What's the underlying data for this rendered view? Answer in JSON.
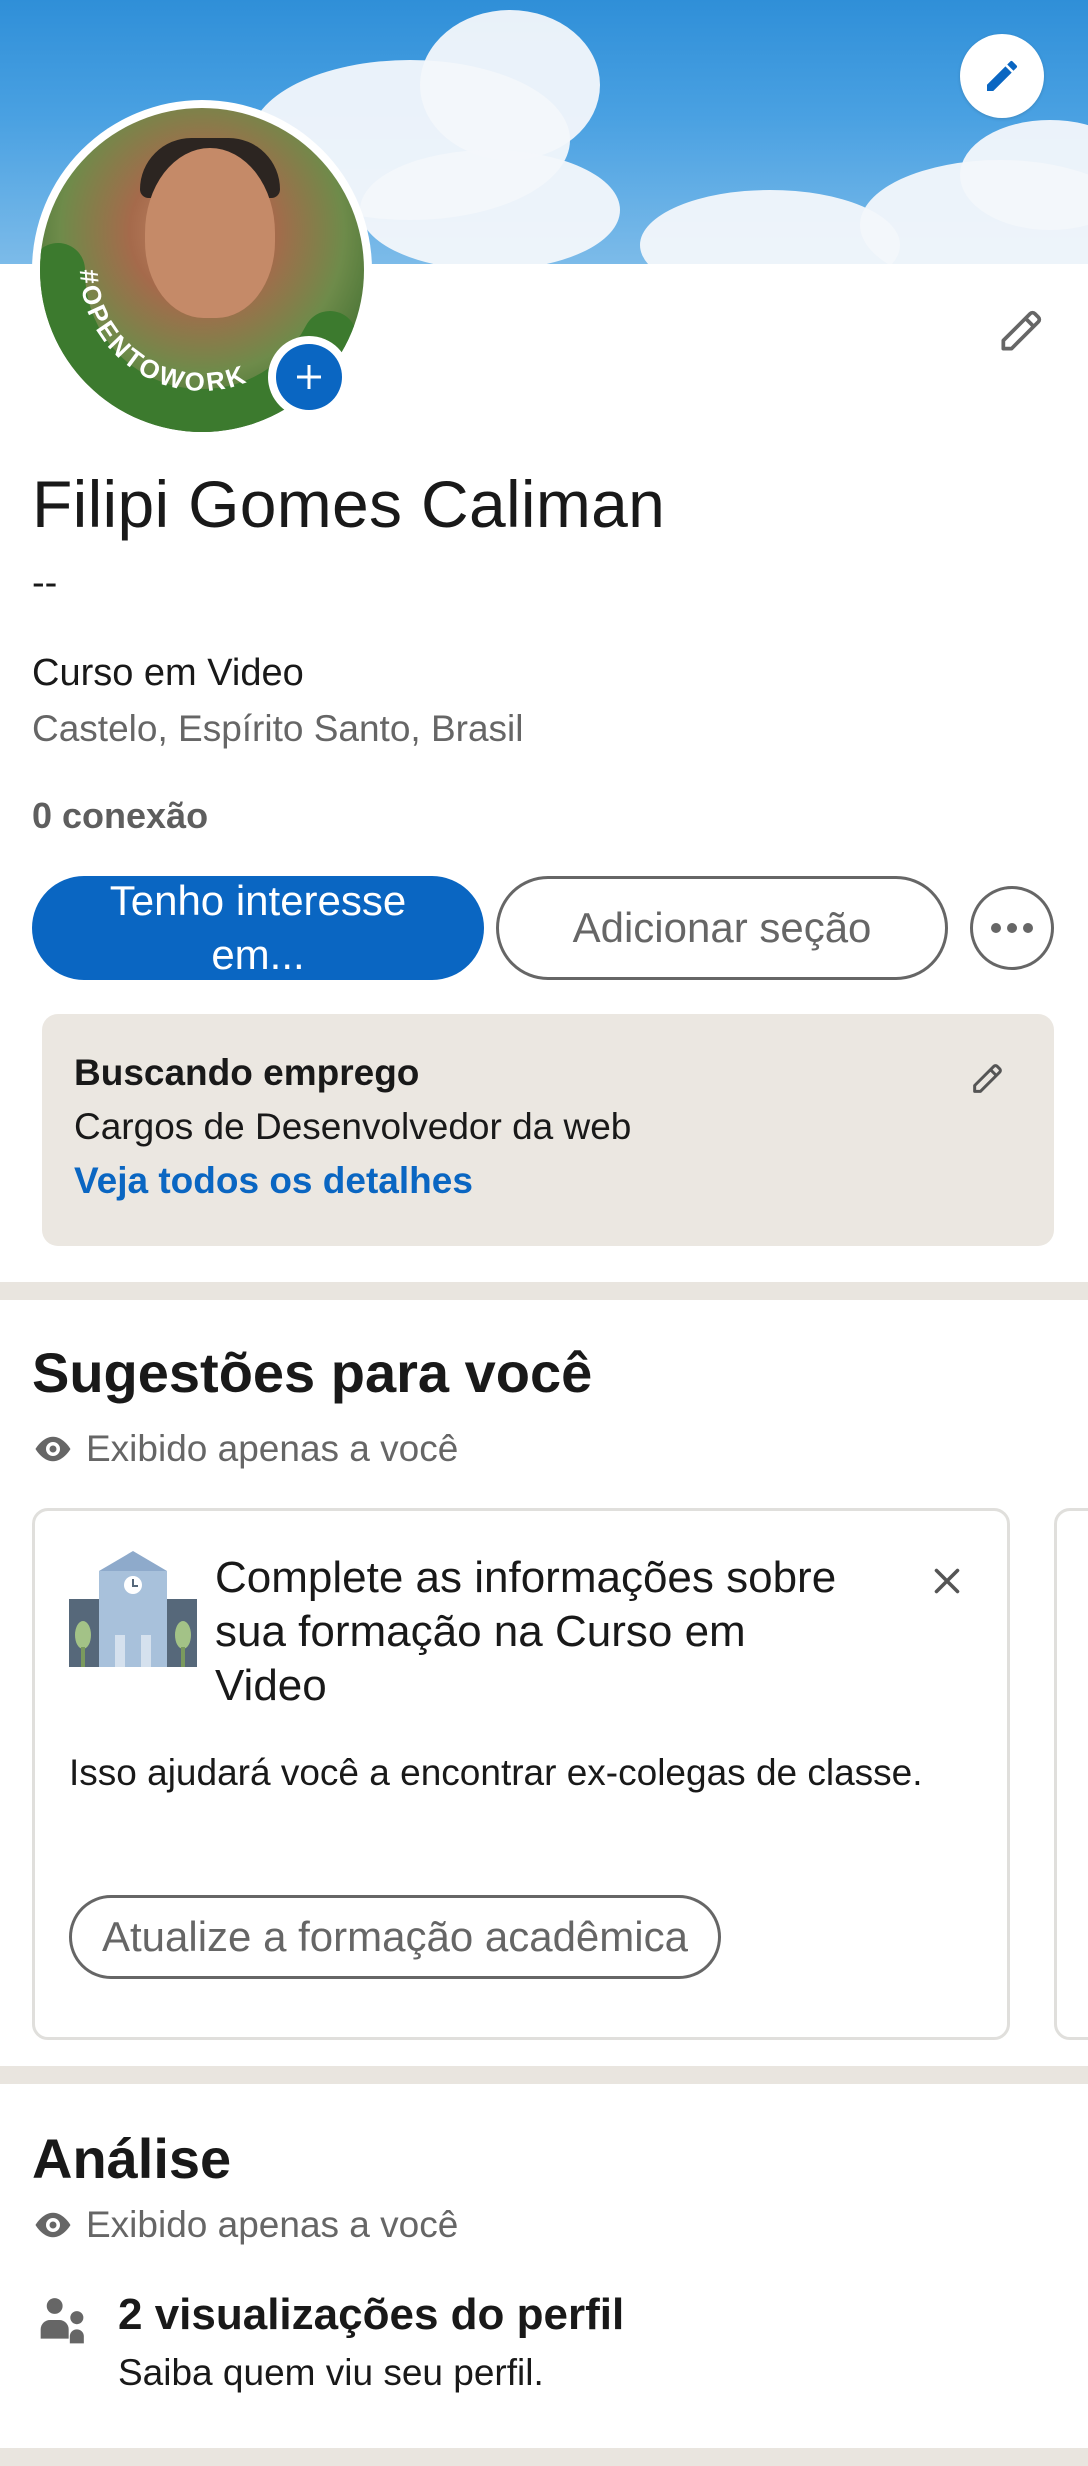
{
  "profile": {
    "name": "Filipi Gomes Caliman",
    "headline": "--",
    "company": "Curso em Video",
    "location": "Castelo, Espírito Santo, Brasil",
    "connections": "0 conexão",
    "badge_text": "#OPENTOWORK"
  },
  "actions": {
    "primary_label": "Tenho interesse em...",
    "secondary_label": "Adicionar seção"
  },
  "open_to_work": {
    "title": "Buscando emprego",
    "roles": "Cargos de Desenvolvedor da web",
    "link": "Veja todos os detalhes"
  },
  "suggestions": {
    "title": "Sugestões para você",
    "privacy": "Exibido apenas a você",
    "card": {
      "title": "Complete as informações sobre sua formação na Curso em Video",
      "description": "Isso ajudará você a encontrar ex-colegas de classe.",
      "button": "Atualize a formação acadêmica"
    }
  },
  "analytics": {
    "title": "Análise",
    "privacy": "Exibido apenas a você",
    "item": {
      "title": "2 visualizações do perfil",
      "subtitle": "Saiba quem viu seu perfil."
    }
  },
  "colors": {
    "brand_blue": "#0a66c2",
    "open_to_work_green": "#3c7a2e",
    "card_beige": "#ebe7e1"
  },
  "icons": [
    "pencil-icon",
    "plus-icon",
    "more-icon",
    "eye-icon",
    "close-icon",
    "school-icon",
    "people-icon"
  ]
}
